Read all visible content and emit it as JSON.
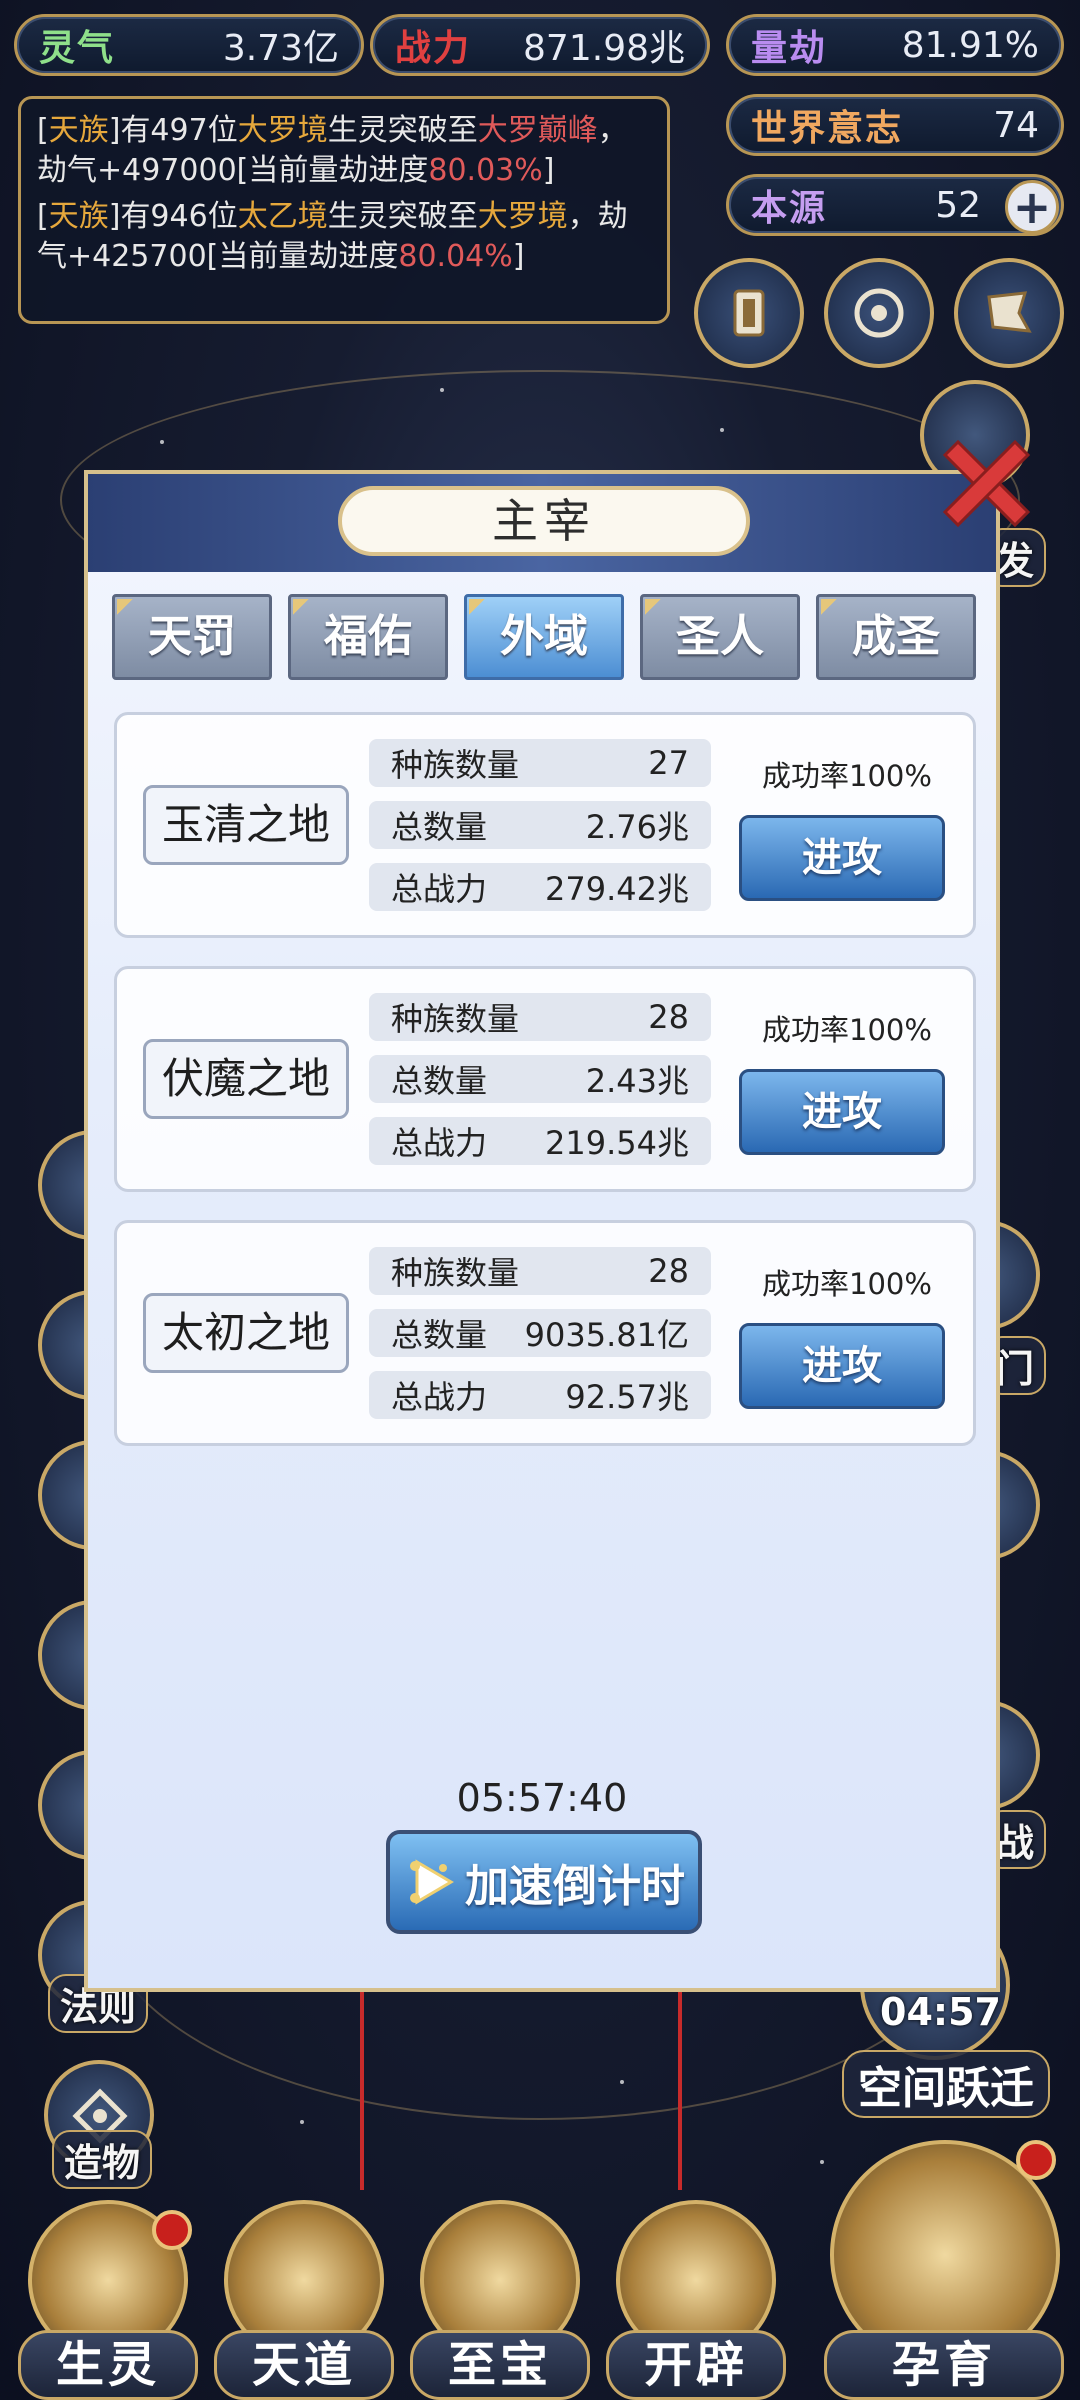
{
  "resources": {
    "lingqi": {
      "label": "灵气",
      "value": "3.73亿",
      "color": "#8fe08a"
    },
    "zhanli": {
      "label": "战力",
      "value": "871.98兆",
      "color": "#e04040"
    },
    "liangjie": {
      "label": "量劫",
      "value": "81.91%",
      "color": "#b98cf0"
    },
    "world_will": {
      "label": "世界意志",
      "value": "74",
      "color": "#f0a860"
    },
    "origin": {
      "label": "本源",
      "value": "52",
      "color": "#c59ef0"
    }
  },
  "log": {
    "line1": {
      "bracket_open": "[",
      "race": "天族",
      "bracket_close": "]",
      "t1": "有497位",
      "realm1": "大罗境",
      "t2": "生灵突破至",
      "realm2": "大罗巅峰",
      "t3": "，劫气+497000[当前量劫进度",
      "progress": "80.03%",
      "t4": "]"
    },
    "line2": {
      "bracket_open": "[",
      "race": "天族",
      "bracket_close": "]",
      "t1": "有946位",
      "realm1": "太乙境",
      "t2": "生灵突破至",
      "realm2": "大罗境",
      "t3": "，劫气+425700[当前量劫进度",
      "progress": "80.04%",
      "t4": "]"
    }
  },
  "side_right_labels": {
    "fa": "发",
    "men": "门",
    "zhan": "战"
  },
  "side_left_labels": {
    "law": "法则",
    "create": "造物"
  },
  "modal": {
    "title": "主宰",
    "tabs": [
      "天罚",
      "福佑",
      "外域",
      "圣人",
      "成圣"
    ],
    "active_tab": 2,
    "cards": [
      {
        "name": "玉清之地",
        "race_label": "种族数量",
        "race_count": "27",
        "total_label": "总数量",
        "total": "2.76兆",
        "power_label": "总战力",
        "power": "279.42兆",
        "rate": "成功率100%",
        "attack": "进攻"
      },
      {
        "name": "伏魔之地",
        "race_label": "种族数量",
        "race_count": "28",
        "total_label": "总数量",
        "total": "2.43兆",
        "power_label": "总战力",
        "power": "219.54兆",
        "rate": "成功率100%",
        "attack": "进攻"
      },
      {
        "name": "太初之地",
        "race_label": "种族数量",
        "race_count": "28",
        "total_label": "总数量",
        "total": "9035.81亿",
        "power_label": "总战力",
        "power": "92.57兆",
        "rate": "成功率100%",
        "attack": "进攻"
      }
    ],
    "countdown": "05:57:40",
    "speed_button": "加速倒计时"
  },
  "space_jump": {
    "time": "04:57",
    "label": "空间跃迁"
  },
  "bottom_nav": [
    {
      "label": "生灵"
    },
    {
      "label": "天道"
    },
    {
      "label": "至宝"
    },
    {
      "label": "开辟"
    },
    {
      "label": "孕育"
    }
  ]
}
